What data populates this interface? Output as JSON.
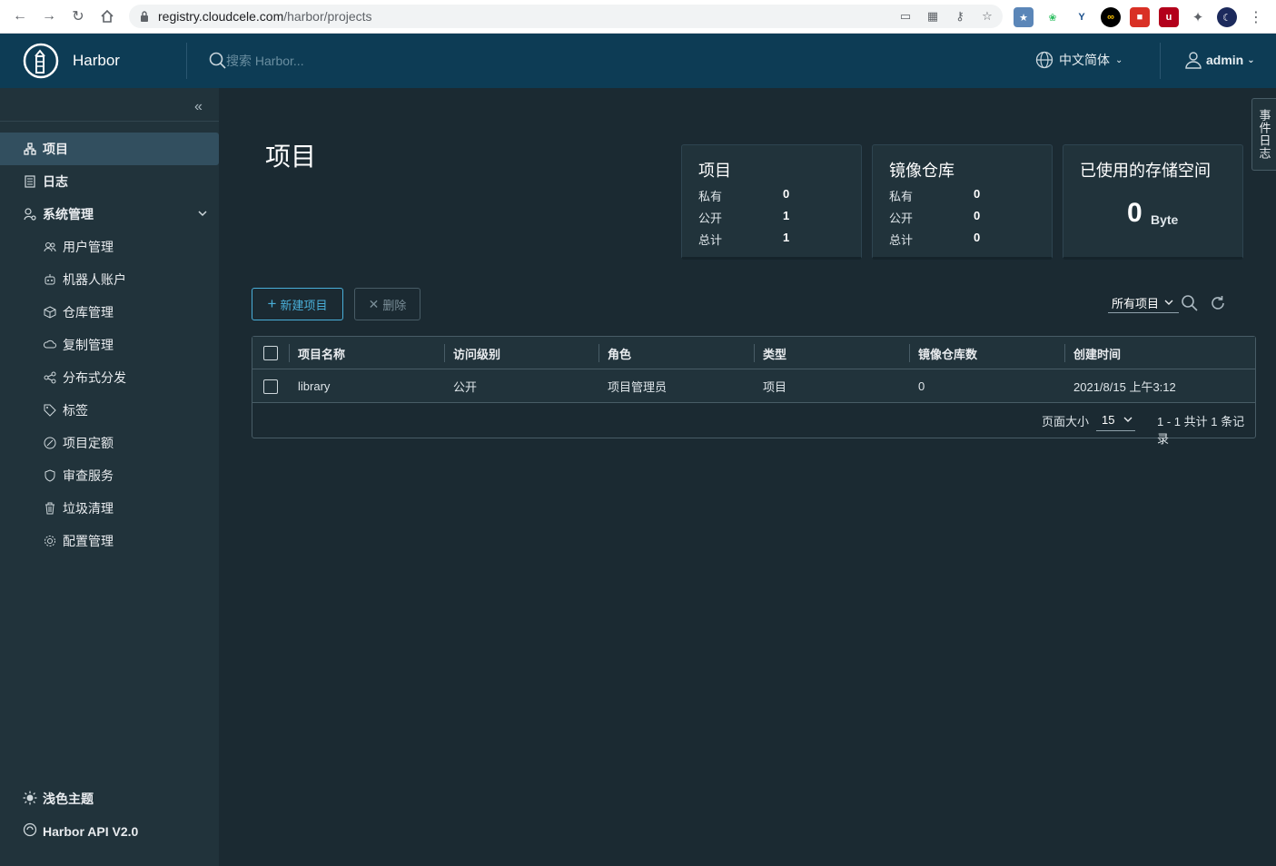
{
  "browser": {
    "url_host": "registry.cloudcele.com",
    "url_path": "/harbor/projects"
  },
  "header": {
    "brand": "Harbor",
    "search_placeholder": "搜索 Harbor...",
    "language": "中文简体",
    "user": "admin"
  },
  "sidebar": {
    "items": [
      {
        "label": "项目",
        "icon": "projects-icon"
      },
      {
        "label": "日志",
        "icon": "logs-icon"
      },
      {
        "label": "系统管理",
        "icon": "admin-icon"
      }
    ],
    "sub_items": [
      {
        "label": "用户管理",
        "icon": "users-icon"
      },
      {
        "label": "机器人账户",
        "icon": "robot-icon"
      },
      {
        "label": "仓库管理",
        "icon": "registry-icon"
      },
      {
        "label": "复制管理",
        "icon": "replication-icon"
      },
      {
        "label": "分布式分发",
        "icon": "distribution-icon"
      },
      {
        "label": "标签",
        "icon": "tag-icon"
      },
      {
        "label": "项目定额",
        "icon": "quota-icon"
      },
      {
        "label": "审查服务",
        "icon": "shield-icon"
      },
      {
        "label": "垃圾清理",
        "icon": "trash-icon"
      },
      {
        "label": "配置管理",
        "icon": "gear-icon"
      }
    ],
    "theme_label": "浅色主题",
    "api_label": "Harbor API V2.0"
  },
  "main": {
    "title": "项目",
    "cards": {
      "projects": {
        "title": "项目",
        "private_label": "私有",
        "private": "0",
        "public_label": "公开",
        "public": "1",
        "total_label": "总计",
        "total": "1"
      },
      "repos": {
        "title": "镜像仓库",
        "private_label": "私有",
        "private": "0",
        "public_label": "公开",
        "public": "0",
        "total_label": "总计",
        "total": "0"
      },
      "storage": {
        "title": "已使用的存储空间",
        "value": "0",
        "unit": "Byte"
      }
    },
    "new_button": "新建项目",
    "delete_button": "删除",
    "filter": "所有项目",
    "table": {
      "columns": [
        "项目名称",
        "访问级别",
        "角色",
        "类型",
        "镜像仓库数",
        "创建时间"
      ],
      "rows": [
        {
          "name": "library",
          "access": "公开",
          "role": "项目管理员",
          "type": "项目",
          "repo_count": "0",
          "created": "2021/8/15 上午3:12"
        }
      ],
      "page_size_label": "页面大小",
      "page_size": "15",
      "summary": "1 - 1 共计 1 条记录"
    },
    "side_tab": "事件日志"
  }
}
